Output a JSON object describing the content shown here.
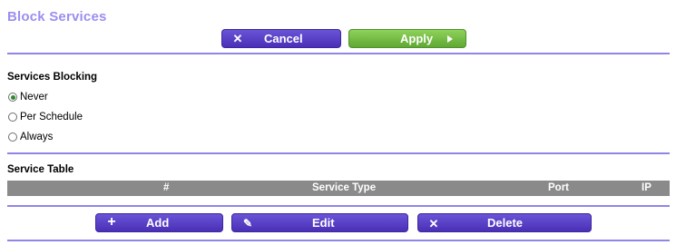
{
  "page": {
    "title": "Block Services"
  },
  "toolbar": {
    "cancel_label": "Cancel",
    "apply_label": "Apply"
  },
  "services_blocking": {
    "title": "Services Blocking",
    "options": [
      {
        "label": "Never",
        "selected": true
      },
      {
        "label": "Per Schedule",
        "selected": false
      },
      {
        "label": "Always",
        "selected": false
      }
    ]
  },
  "service_table": {
    "title": "Service Table",
    "columns": [
      "#",
      "Service Type",
      "Port",
      "IP"
    ],
    "rows": []
  },
  "table_actions": {
    "add_label": "Add",
    "edit_label": "Edit",
    "delete_label": "Delete"
  },
  "colors": {
    "accent_purple": "#4a2fb6",
    "accent_green": "#5fa834",
    "title_purple": "#9a8ef0",
    "divider": "#8f86e8",
    "table_header": "#8a8a8a"
  }
}
